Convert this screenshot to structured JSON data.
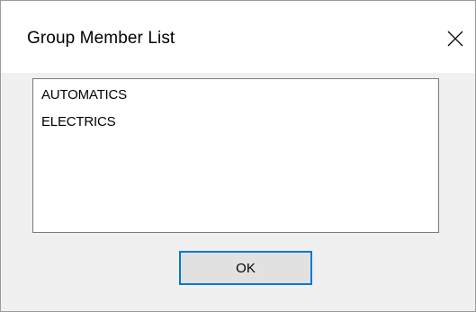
{
  "dialog": {
    "title": "Group Member List",
    "close_icon": "close-icon"
  },
  "list": {
    "items": [
      {
        "label": "AUTOMATICS"
      },
      {
        "label": "ELECTRICS"
      }
    ]
  },
  "buttons": {
    "ok_label": "OK"
  },
  "colors": {
    "background": "#f0f0f0",
    "titlebar": "#ffffff",
    "focus_border": "#0078d7",
    "button_face": "#e1e1e1"
  }
}
